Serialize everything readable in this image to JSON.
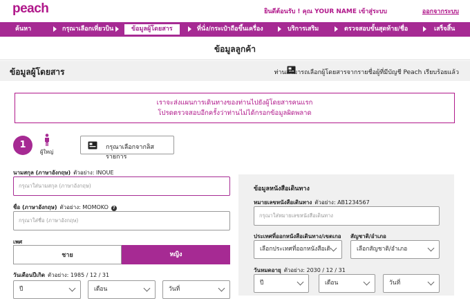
{
  "header": {
    "logo": "peach",
    "welcome": "ยินดีต้อนรับ ! คุณ YOUR NAME เข้าสู่ระบบ",
    "logout": "ออกจากระบบ"
  },
  "nav": {
    "steps": [
      {
        "label": "ค้นหา"
      },
      {
        "label": "กรุณาเลือกเที่ยวบิน"
      },
      {
        "label": "ข้อมูลผู้โดยสาร"
      },
      {
        "label": "ที่นั่ง/กระเป๋าถือขึ้นเครื่อง"
      },
      {
        "label": "บริการเสริม"
      },
      {
        "label": "ตรวจสอบขั้นสุดท้าย/ชื่อ"
      },
      {
        "label": "เสร็จสิ้น"
      }
    ],
    "active_index": 2
  },
  "page": {
    "title": "ข้อมูลลูกค้า",
    "section_title": "ข้อมูลผู้โดยสาร",
    "section_note": "ท่านสามารถเลือกผู้โดยสารจากรายชื่อผู้ที่มีบัญชี Peach เรียบร้อยแล้ว"
  },
  "notice": {
    "line1": "เราจะส่งแผนการเดินทางของท่านไปยังผู้โดยสารคนแรก",
    "line2": "โปรดตรวจสอบอีกครั้งว่าท่านไม่ได้กรอกข้อมูลผิดพลาด"
  },
  "passenger": {
    "number": "1",
    "type": "ผู้ใหญ่",
    "choose_button": "กรุณาเลือกจากลิสรายการ",
    "surname": {
      "label": "นามสกุล (ภาษาอังกฤษ)",
      "example": "ตัวอย่าง: INOUE",
      "placeholder": "กรุณาใส่นามสกุล (ภาษาอังกฤษ)"
    },
    "firstname": {
      "label": "ชื่อ (ภาษาอังกฤษ)",
      "example": "ตัวอย่าง: MOMOKO",
      "placeholder": "กรุณาใส่ชื่อ (ภาษาอังกฤษ)"
    },
    "gender": {
      "label": "เพศ",
      "male": "ชาย",
      "female": "หญิง",
      "selected": "female"
    },
    "dob": {
      "label": "วันเดือนปีเกิด",
      "example": "ตัวอย่าง: 1985 / 12 / 31",
      "year": "ปี",
      "month": "เดือน",
      "day": "วันที่"
    }
  },
  "passport": {
    "title": "ข้อมูลหนังสือเดินทาง",
    "number": {
      "label": "หมายเลขหนังสือเดินทาง",
      "example": "ตัวอย่าง: AB1234567",
      "placeholder": "กรุณาใส่หมายเลขหนังสือเดินทาง"
    },
    "country": {
      "label": "ประเทศที่ออกหนังสือเดินทาง/เขตเกอ",
      "value": "เลือกประเทศที่ออกหนังสือเดิ"
    },
    "nationality": {
      "label": "สัญชาติ/อำเภอ",
      "value": "เลือกสัญชาติ/อำเภอ"
    },
    "expiry": {
      "label": "วันหมดอายุ",
      "example": "ตัวอย่าง: 2030 / 12 / 31",
      "year": "ปี",
      "month": "เดือน",
      "day": "วันที่"
    }
  },
  "colors": {
    "brand": "#a62a93",
    "accent": "#b0178a"
  }
}
